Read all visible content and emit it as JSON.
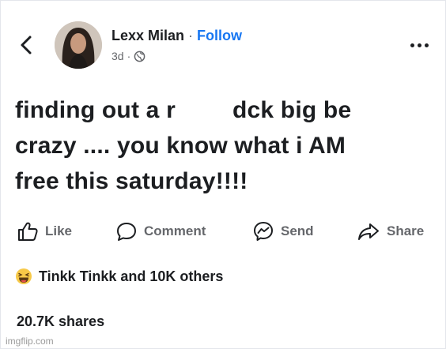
{
  "post": {
    "author": "Lexx Milan",
    "separator": "·",
    "follow_label": "Follow",
    "time": "3d",
    "meta_separator": "·",
    "lines": [
      {
        "before": "finding out a r",
        "after": "dck big be"
      },
      {
        "text": "crazy .... you know what i AM"
      },
      {
        "text": "free this saturday!!!!"
      }
    ]
  },
  "actions": {
    "like": "Like",
    "comment": "Comment",
    "send": "Send",
    "share": "Share"
  },
  "reactions": {
    "text": "Tinkk Tinkk and 10K others",
    "icon": "haha-emoji-icon"
  },
  "stats": {
    "shares": "20.7K shares"
  },
  "watermark": "imgflip.com",
  "colors": {
    "follow": "#1877f2",
    "muted": "#65676b",
    "text": "#1c1e21"
  }
}
